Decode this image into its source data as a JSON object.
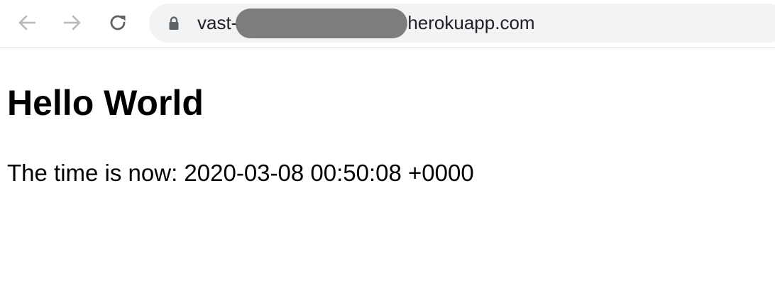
{
  "browser": {
    "icons": {
      "back": "arrow-left-icon",
      "forward": "arrow-right-icon",
      "reload": "reload-icon",
      "lock": "lock-icon"
    },
    "url_prefix": "vast-",
    "url_suffix": "herokuapp.com",
    "omnibox_bg": "#f1f3f4"
  },
  "page": {
    "heading": "Hello World",
    "time_label": "The time is now:",
    "time_value": "2020-03-08 00:50:08 +0000"
  }
}
